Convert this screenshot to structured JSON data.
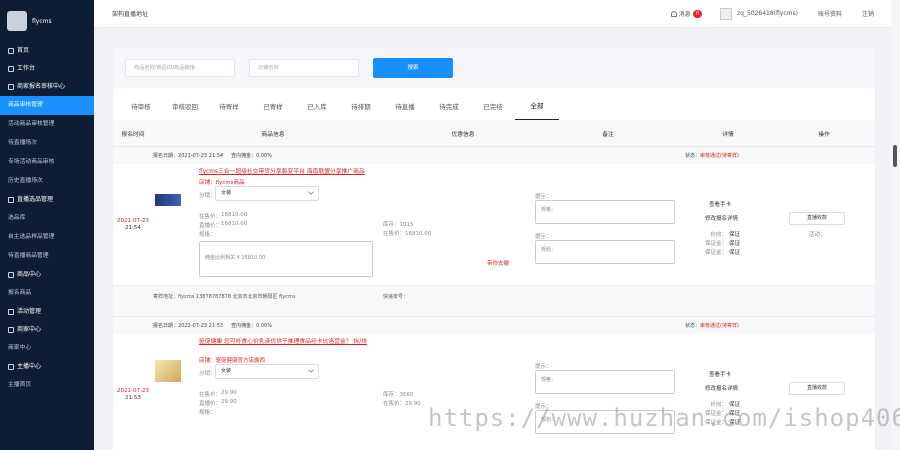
{
  "brand": {
    "name": "flycms"
  },
  "sidebar": {
    "groups": [
      {
        "label": "首页",
        "section": true
      },
      {
        "label": "工作台",
        "section": true
      },
      {
        "label": "商家报名审核中心",
        "section": true
      },
      {
        "label": "商品审核管理",
        "active": true
      },
      {
        "label": "活动商品审核管理"
      },
      {
        "label": "待直播场次"
      },
      {
        "label": "专场活动商品审核"
      },
      {
        "label": "历史直播场次"
      },
      {
        "label": "直播选品管理",
        "section": true
      },
      {
        "label": "选品库"
      },
      {
        "label": "自主选品样品管理"
      },
      {
        "label": "待直播商品管理"
      },
      {
        "label": "商品中心",
        "section": true
      },
      {
        "label": "报名商品"
      },
      {
        "label": "活动管理",
        "section": true
      },
      {
        "label": "商家中心",
        "section": true
      },
      {
        "label": "商家中心"
      },
      {
        "label": "主播中心",
        "section": true
      },
      {
        "label": "主播首页"
      }
    ]
  },
  "topbar": {
    "title": "架构直播地址",
    "messages_label": "消息",
    "messages_count": "0",
    "user": "zq_5026418(flycms)",
    "account": "账号资料",
    "logout": "注销"
  },
  "filter": {
    "product_placeholder": "商品名称/商品ID/商品链接",
    "store_placeholder": "店铺名称",
    "search_button": "搜索"
  },
  "tabs": [
    "待审核",
    "审核驳回",
    "待寄样",
    "已寄样",
    "已入库",
    "待排期",
    "待直播",
    "待完成",
    "已完结",
    "全部"
  ],
  "columns": [
    "报名时间",
    "商品信息",
    "优惠信息",
    "备注",
    "详情",
    "操作"
  ],
  "orders": [
    {
      "signup_date": "报名日期：2021-07-23 21:54",
      "commission": "查内佣金：0.00%",
      "status_label": "状态：",
      "status_value": "审核通过(待寄样)",
      "date": "2021-07-23",
      "time": "21:54",
      "title": "flycms三合一超级社交带货分享裂变平台 海南联盟分享推广商品",
      "store": "店铺：flycms商品",
      "sku_label": "分销：",
      "sku_value": "女装",
      "price_label": "在售价：",
      "price": "16810.00",
      "live_price_label": "直播价：",
      "live_price": "16810.00",
      "spec_label": "规格：",
      "coupon_box": "佣金比例相关 ¥ 16810.00",
      "promo_stock": "库存：1015",
      "promo_price": "在售价：16810.00",
      "promo_link": "带你去搬",
      "note1_label": "提示：",
      "note1_ph": "规格：",
      "note2_label": "提示：",
      "note2_ph": "规划：",
      "view_sample": "查看手卡",
      "edit_signup": "修改报名详情",
      "d1": "价向：",
      "d1v": "保证",
      "d2": "保证金：",
      "d2v": "保证",
      "d3": "保证金：",
      "d3v": "保证",
      "op_button": "直播收款",
      "op_act": "活动：",
      "address": "寄样地址：flycms 13878787878 北京市北京市朝阳区 flycms",
      "express": "快递单号："
    },
    {
      "signup_date": "报名日期：2021-07-23 21:53",
      "commission": "查内佣金：0.00%",
      "status_label": "状态：",
      "status_value": "审核通过(待寄样)",
      "date": "2021-07-23",
      "time": "21:53",
      "title": "驱促健康 您可杯食心价乳液优供于推理食品经卡比洛营金？ 拆/烧",
      "store": "店铺：驱促健康官方店露西",
      "sku_label": "分销：",
      "sku_value": "女装",
      "price_label": "在售价：",
      "price": "29.90",
      "live_price_label": "直播价：",
      "live_price": "29.90",
      "spec_label": "规格：",
      "promo_stock": "库存：3660",
      "promo_price": "在售价：29.90",
      "note1_label": "提示：",
      "note1_ph": "规格：",
      "note2_label": "提示：",
      "note2_ph": "规划：",
      "view_sample": "查看手卡",
      "edit_signup": "修改报名详情",
      "d1": "价向：",
      "d1v": "保证",
      "d2": "保证金：",
      "d2v": "保证",
      "d3": "保证金：",
      "d3v": "保证",
      "op_button": "直播收款"
    }
  ],
  "watermark": "https://www.huzhan.com/ishop4066",
  "colors": {
    "sidebar": "#0e1d36",
    "accent": "#1890ff",
    "danger": "#e02020"
  }
}
